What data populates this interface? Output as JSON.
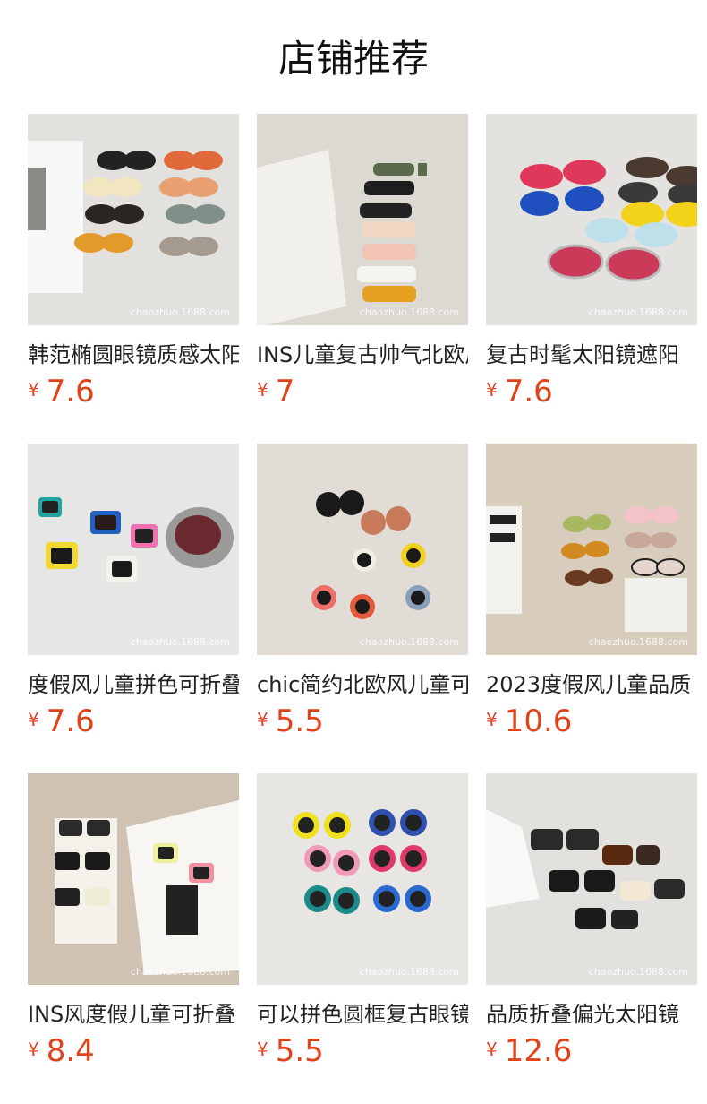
{
  "header": {
    "title": "店铺推荐"
  },
  "currency": "¥",
  "products": [
    {
      "title": "韩范椭圆眼镜质感太阳镜",
      "price": "7.6",
      "watermark": "chaozhuo.1688.com",
      "bg": "#e3e1de"
    },
    {
      "title": "INS儿童复古帅气北欧风",
      "price": "7",
      "watermark": "chaozhuo.1688.com",
      "bg": "#dcd8d2"
    },
    {
      "title": "复古时髦太阳镜遮阳",
      "price": "7.6",
      "watermark": "chaozhuo.1688.com",
      "bg": "#e4e2df"
    },
    {
      "title": "度假风儿童拼色可折叠",
      "price": "7.6",
      "watermark": "chaozhuo.1688.com",
      "bg": "#e6e6e4"
    },
    {
      "title": "chic简约北欧风儿童可",
      "price": "5.5",
      "watermark": "chaozhuo.1688.com",
      "bg": "#e2dcd6"
    },
    {
      "title": "2023度假风儿童品质",
      "price": "10.6",
      "watermark": "chaozhuo.1688.com",
      "bg": "#d8cdbd"
    },
    {
      "title": "INS风度假儿童可折叠",
      "price": "8.4",
      "watermark": "chaozhuo.1688.com",
      "bg": "#cfc2b2"
    },
    {
      "title": "可以拼色圆框复古眼镜",
      "price": "5.5",
      "watermark": "chaozhuo.1688.com",
      "bg": "#e8e6e2"
    },
    {
      "title": "品质折叠偏光太阳镜",
      "price": "12.6",
      "watermark": "chaozhuo.1688.com",
      "bg": "#e2e1de"
    }
  ]
}
